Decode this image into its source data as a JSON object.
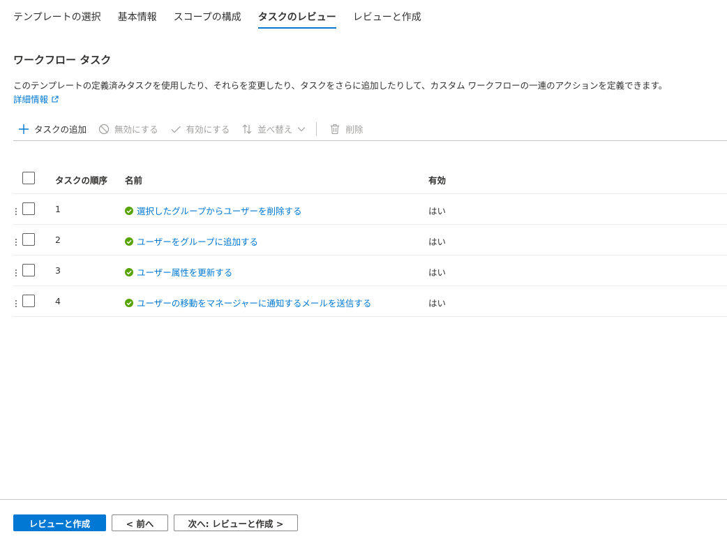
{
  "tabs": [
    {
      "label": "テンプレートの選択",
      "active": false
    },
    {
      "label": "基本情報",
      "active": false
    },
    {
      "label": "スコープの構成",
      "active": false
    },
    {
      "label": "タスクのレビュー",
      "active": true
    },
    {
      "label": "レビューと作成",
      "active": false
    }
  ],
  "section": {
    "title": "ワークフロー タスク",
    "description": "このテンプレートの定義済みタスクを使用したり、それらを変更したり、タスクをさらに追加したりして、カスタム ワークフローの一連のアクションを定義できます。",
    "learn_more": "詳細情報"
  },
  "toolbar": {
    "add_task": "タスクの追加",
    "disable": "無効にする",
    "enable": "有効にする",
    "sort": "並べ替え",
    "delete": "削除"
  },
  "table": {
    "headers": {
      "order": "タスクの順序",
      "name": "名前",
      "enabled": "有効"
    },
    "rows": [
      {
        "order": "1",
        "name": "選択したグループからユーザーを削除する",
        "enabled": "はい"
      },
      {
        "order": "2",
        "name": "ユーザーをグループに追加する",
        "enabled": "はい"
      },
      {
        "order": "3",
        "name": "ユーザー属性を更新する",
        "enabled": "はい"
      },
      {
        "order": "4",
        "name": "ユーザーの移動をマネージャーに通知するメールを送信する",
        "enabled": "はい"
      }
    ]
  },
  "footer": {
    "review_create": "レビューと作成",
    "prev": "< 前へ",
    "next": "次へ: レビューと作成 >"
  },
  "colors": {
    "accent": "#0078d4",
    "success": "#57a300",
    "text": "#323130",
    "disabled": "#a19f9d"
  }
}
